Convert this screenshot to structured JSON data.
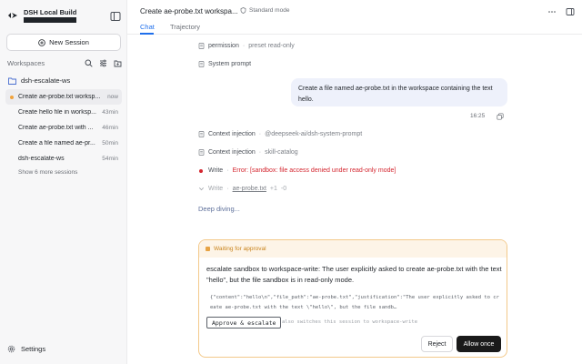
{
  "sidebar": {
    "brand_name": "DSH Local Build",
    "brand_sub": "",
    "new_session_label": "New Session",
    "workspaces_title": "Workspaces",
    "workspace_name": "dsh-escalate-ws",
    "sessions": [
      {
        "title": "Create ae-probe.txt worksp...",
        "time": "now",
        "active": true
      },
      {
        "title": "Create hello file in worksp...",
        "time": "43min",
        "active": false
      },
      {
        "title": "Create ae-probe.txt with ...",
        "time": "46min",
        "active": false
      },
      {
        "title": "Create a file named ae-pr...",
        "time": "50min",
        "active": false
      },
      {
        "title": "dsh-escalate-ws",
        "time": "54min",
        "active": false
      }
    ],
    "show_more": "Show 6 more sessions",
    "settings_label": "Settings"
  },
  "header": {
    "title": "Create ae-probe.txt workspa...",
    "mode": "Standard mode",
    "tabs": [
      "Chat",
      "Trajectory"
    ]
  },
  "chat": {
    "permission_label": "permission",
    "permission_value": "preset read-only",
    "system_prompt_label": "System prompt",
    "user_message": "Create a file named ae-probe.txt in the workspace containing the text hello.",
    "message_time": "16:25",
    "ctx1_label": "Context injection",
    "ctx1_value": "@deepseek-ai/dsh-system-prompt",
    "ctx2_label": "Context injection",
    "ctx2_value": "skill-catalog",
    "write_label": "Write",
    "write_error": "Error: [sandbox: file access denied under read-only mode]",
    "write2_label": "Write",
    "write2_file": "ae-probe.txt",
    "write2_add": "+1",
    "write2_del": "-0",
    "deep_diving": "Deep diving..."
  },
  "approval": {
    "status": "Waiting for approval",
    "text": "escalate sandbox to workspace-write: The user explicitly asked to create ae-probe.txt with the text \"hello\", but the file sandbox is in read-only mode.",
    "code": "{\"content\":\"hello\\n\",\"file_path\":\"ae-probe.txt\",\"justification\":\"The user explicitly asked to create ae-probe.txt with the text \\\"hello\\\", but the file sandb…",
    "approve_escalate": "Approve & escalate",
    "approve_hint": "also switches this session to workspace-write",
    "reject": "Reject",
    "allow_once": "Allow once"
  },
  "colors": {
    "accent": "#1f6feb",
    "error": "#d4262f",
    "warning": "#e7a344",
    "bubble": "#eef1fb"
  }
}
